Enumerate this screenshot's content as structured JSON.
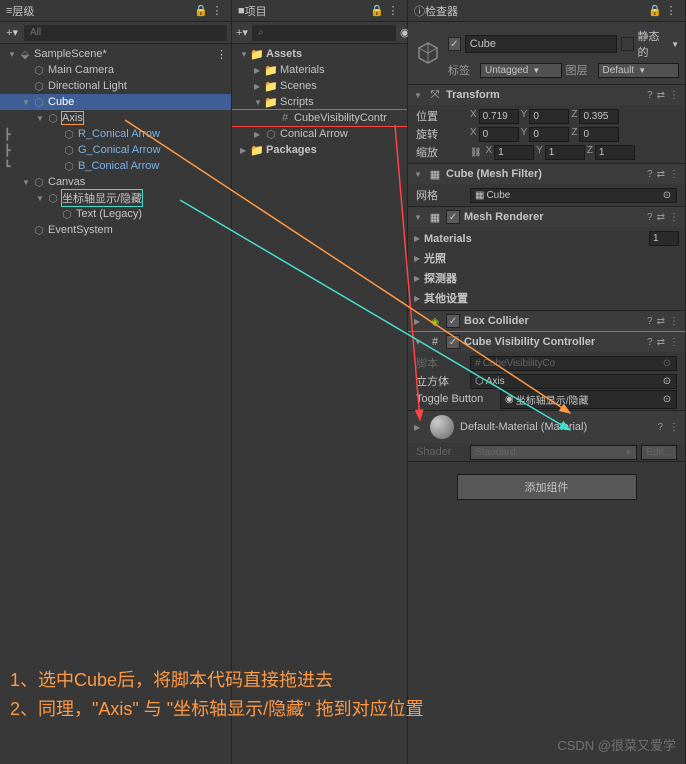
{
  "hierarchy": {
    "title": "层级",
    "search_placeholder": "All",
    "scene": "SampleScene*",
    "items": {
      "camera": "Main Camera",
      "light": "Directional Light",
      "cube": "Cube",
      "axis": "Axis",
      "r_arrow": "R_Conical Arrow",
      "g_arrow": "G_Conical Arrow",
      "b_arrow": "B_Conical Arrow",
      "canvas": "Canvas",
      "toggle_btn": "坐标轴显示/隐藏",
      "text_legacy": "Text (Legacy)",
      "event_system": "EventSystem"
    }
  },
  "project": {
    "title": "项目",
    "assets": "Assets",
    "materials": "Materials",
    "scenes": "Scenes",
    "scripts": "Scripts",
    "script_file": "CubeVisibilityContr",
    "conical_arrow": "Conical Arrow",
    "packages": "Packages"
  },
  "inspector": {
    "title": "检查器",
    "object_name": "Cube",
    "static_label": "静态的",
    "tag_label": "标签",
    "tag_value": "Untagged",
    "layer_label": "图层",
    "layer_value": "Default",
    "transform": {
      "title": "Transform",
      "pos_label": "位置",
      "rot_label": "旋转",
      "scale_label": "缩放",
      "pos": {
        "x": "0.719",
        "y": "0",
        "z": "0.395"
      },
      "rot": {
        "x": "0",
        "y": "0",
        "z": "0"
      },
      "scale": {
        "x": "1",
        "y": "1",
        "z": "1"
      }
    },
    "mesh_filter": {
      "title": "Cube (Mesh Filter)",
      "mesh_label": "网格",
      "mesh_value": "Cube"
    },
    "mesh_renderer": {
      "title": "Mesh Renderer",
      "materials": "Materials",
      "materials_count": "1",
      "lighting": "光照",
      "probes": "探测器",
      "other": "其他设置"
    },
    "box_collider": {
      "title": "Box Collider"
    },
    "script_component": {
      "title": "Cube Visibility Controller",
      "script_label": "脚本",
      "script_value": "CubeVisibilityCo",
      "cube_label": "立方体",
      "cube_value": "Axis",
      "toggle_label": "Toggle Button",
      "toggle_value": "坐标轴显示/隐藏"
    },
    "material": {
      "title": "Default-Material (Material)",
      "shader_label": "Shader",
      "shader_value": "Standard",
      "edit": "Edit..."
    },
    "add_component": "添加组件"
  },
  "annotation": {
    "line1": "1、选中Cube后，将脚本代码直接拖进去",
    "line2": "2、同理，\"Axis\" 与 \"坐标轴显示/隐藏\" 拖到对应位置"
  },
  "watermark": "CSDN @很菜又爱学"
}
